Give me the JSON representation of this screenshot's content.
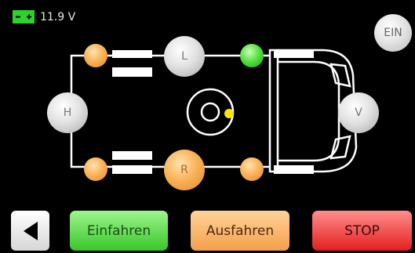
{
  "status": {
    "battery_icon": "battery-icon",
    "voltage": "11.9 V"
  },
  "ein_button": {
    "label": "EIN"
  },
  "nodes": {
    "left": "H",
    "top_middle": "L",
    "bottom_middle": "R",
    "front": "V"
  },
  "buttons": {
    "back_icon": "triangle-left-icon",
    "retract": "Einfahren",
    "extend": "Ausfahren",
    "stop": "STOP"
  },
  "colors": {
    "background": "#000000",
    "line": "#ffffff",
    "battery": "#2bd32b",
    "center_dot": "#ffe600",
    "active_node": "#4fdd3b",
    "valve_node": "#f9b45a",
    "retract_button": "#4fdc3c",
    "extend_button": "#f7b567",
    "stop_button": "#f23a3a"
  }
}
